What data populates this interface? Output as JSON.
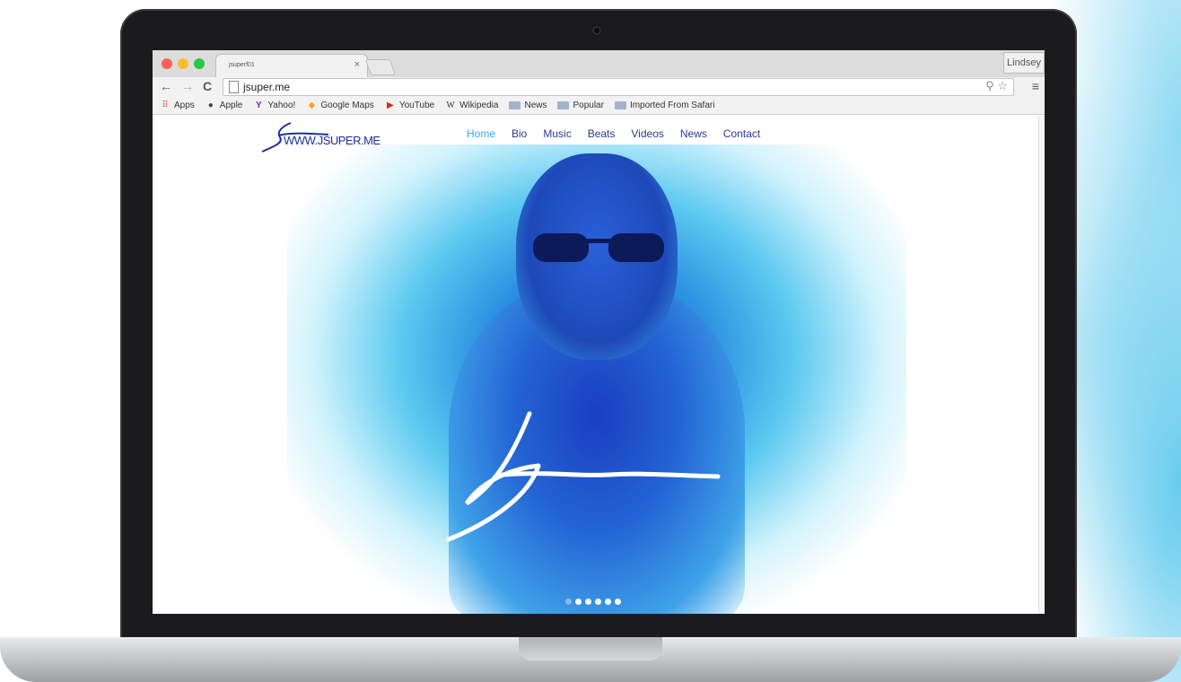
{
  "browser": {
    "tab_title": "jsuperf01",
    "tab_close": "×",
    "profile": "Lindsey",
    "url": "jsuper.me",
    "colors": {
      "close": "#fc5f57",
      "minimize": "#fdbc2e",
      "maximize": "#28c840"
    }
  },
  "bookmarks": [
    {
      "label": "Apps",
      "icon": "apps-grid-icon"
    },
    {
      "label": "Apple",
      "icon": "apple-icon"
    },
    {
      "label": "Yahoo!",
      "icon": "yahoo-icon"
    },
    {
      "label": "Google Maps",
      "icon": "maps-icon"
    },
    {
      "label": "YouTube",
      "icon": "youtube-icon"
    },
    {
      "label": "Wikipedia",
      "icon": "wikipedia-icon"
    },
    {
      "label": "News",
      "icon": "folder-icon"
    },
    {
      "label": "Popular",
      "icon": "folder-icon"
    },
    {
      "label": "Imported From Safari",
      "icon": "folder-icon"
    }
  ],
  "site": {
    "logo_text": "WWW.JSUPER.ME",
    "nav": [
      {
        "label": "Home",
        "active": true
      },
      {
        "label": "Bio"
      },
      {
        "label": "Music"
      },
      {
        "label": "Beats"
      },
      {
        "label": "Videos"
      },
      {
        "label": "News"
      },
      {
        "label": "Contact"
      }
    ],
    "slider": {
      "count": 6,
      "active": 1
    }
  }
}
